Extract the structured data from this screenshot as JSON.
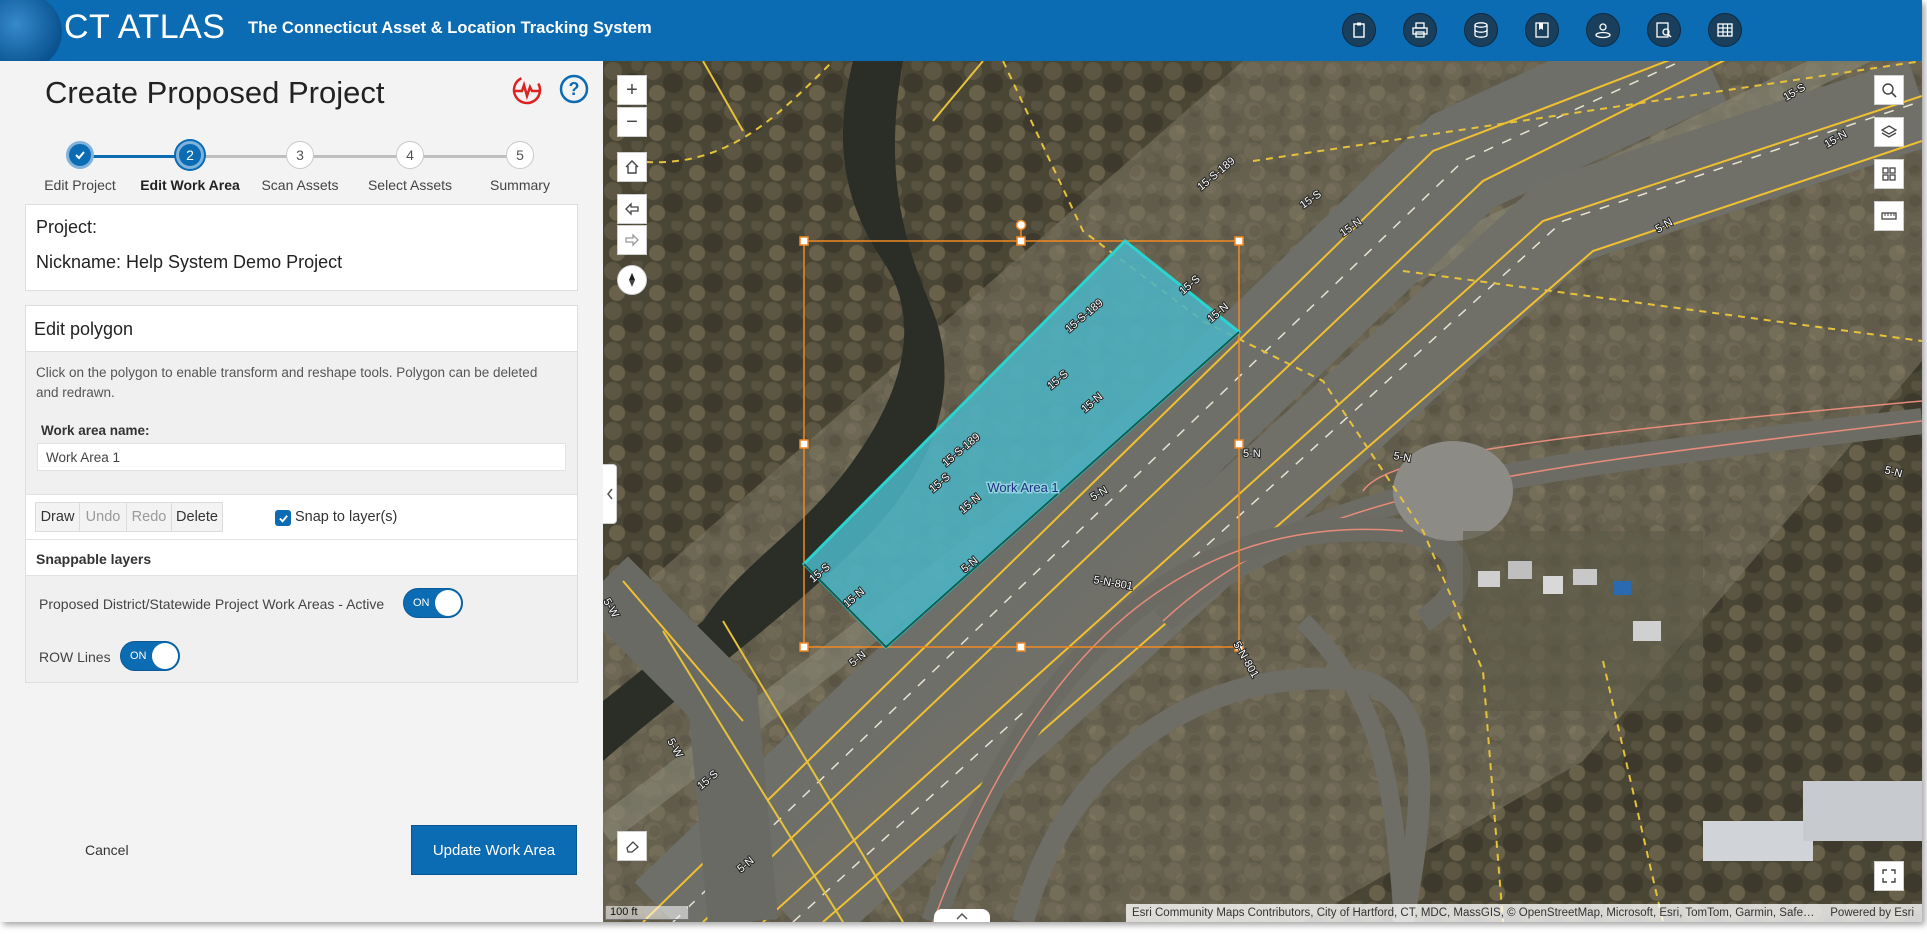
{
  "header": {
    "title": "CT ATLAS",
    "subtitle": "The Connecticut Asset & Location Tracking System",
    "buttons": [
      "clipboard-icon",
      "print-icon",
      "database-icon",
      "bookmark-icon",
      "user-location-icon",
      "search-document-icon",
      "table-icon"
    ]
  },
  "panel": {
    "title": "Create Proposed Project",
    "steps": [
      {
        "number": "1",
        "label": "Edit Project",
        "state": "done"
      },
      {
        "number": "2",
        "label": "Edit Work Area",
        "state": "active"
      },
      {
        "number": "3",
        "label": "Scan Assets",
        "state": "todo"
      },
      {
        "number": "4",
        "label": "Select Assets",
        "state": "todo"
      },
      {
        "number": "5",
        "label": "Summary",
        "state": "todo"
      }
    ],
    "project_label": "Project:",
    "nickname": "Nickname: Help System Demo Project",
    "edit_polygon": {
      "title": "Edit polygon",
      "description": "Click on the polygon to enable transform and reshape tools. Polygon can be deleted and redrawn.",
      "work_area_label": "Work area name:",
      "work_area_value": "Work Area 1",
      "tools": {
        "draw": "Draw",
        "undo": "Undo",
        "redo": "Redo",
        "delete": "Delete"
      },
      "snap_label": "Snap to layer(s)",
      "snap_checked": true,
      "snappable_title": "Snappable layers",
      "layers": [
        {
          "label": "Proposed District/Statewide Project Work Areas - Active",
          "toggle": "ON"
        },
        {
          "label": "ROW Lines",
          "toggle": "ON"
        }
      ]
    },
    "cancel": "Cancel",
    "update": "Update Work Area"
  },
  "map": {
    "zoom_in": "+",
    "zoom_out": "−",
    "polygon_label": "Work Area 1",
    "road_labels": [
      "15-S",
      "15-N",
      "15-S-189",
      "15-S",
      "15-N",
      "15-S-189",
      "15-S",
      "15-N",
      "15-S",
      "15-N",
      "5-N",
      "5-N",
      "5-N",
      "5-N",
      "5-N-801",
      "5-N",
      "15-S",
      "15-N",
      "5-N",
      "15-S",
      "15-N",
      "15-S",
      "15-S-189",
      "5-W",
      "5-W",
      "5-N-801",
      "5-N",
      "5-N"
    ],
    "scale": "100 ft",
    "attribution": "Esri Community Maps Contributors, City of Hartford, CT, MDC, MassGIS, © OpenStreetMap, Microsoft, Esri, TomTom, Garmin, SafeGraph, GeoTechnologies, Inc, METI/NASA, USGS, EPA, NPS, US Census Bureau, USDA, USFWS",
    "powered_by": "Powered by Esri"
  },
  "colors": {
    "header": "#0b6bb3",
    "polygon_fill": "#4bb3c4",
    "polygon_edge": "#2bd4d0",
    "selection_box": "#f08a24"
  }
}
